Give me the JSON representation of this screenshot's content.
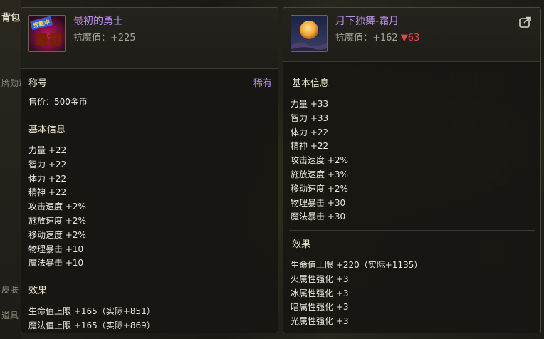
{
  "background": {
    "left_labels": [
      "背包",
      "牌勋章",
      "皮肤",
      "道具"
    ]
  },
  "left_item": {
    "name": "最初的勇士",
    "resist_text": "抗魔值：+225",
    "icon_badge": "穿戴中",
    "icon_text": "最初",
    "title_label": "称号",
    "rarity": "稀有",
    "price": "售价：500金币",
    "basic_info_title": "基本信息",
    "stats": [
      "力量 +22",
      "智力 +22",
      "体力 +22",
      "精神 +22",
      "攻击速度 +2%",
      "施放速度 +2%",
      "移动速度 +2%",
      "物理暴击 +10",
      "魔法暴击 +10"
    ],
    "effects_title": "效果",
    "effects": [
      "生命值上限 +165（实际+851）",
      "魔法值上限 +165（实际+869）"
    ]
  },
  "right_item": {
    "name": "月下独舞-霜月",
    "resist_prefix": "抗魔值：+162",
    "resist_diff": "▼63",
    "basic_info_title": "基本信息",
    "stats": [
      "力量 +33",
      "智力 +33",
      "体力 +22",
      "精神 +22",
      "攻击速度 +2%",
      "施放速度 +3%",
      "移动速度 +2%",
      "物理暴击 +30",
      "魔法暴击 +30"
    ],
    "effects_title": "效果",
    "effects": [
      "生命值上限 +220（实际+1135）",
      "火属性强化 +3",
      "冰属性强化 +3",
      "暗属性强化 +3",
      "光属性强化 +3"
    ]
  },
  "colors": {
    "item_name": "#b98fe6",
    "rarity": "#b98fe6",
    "decrease": "#e2463f"
  },
  "icons": {
    "share": "share-icon"
  }
}
